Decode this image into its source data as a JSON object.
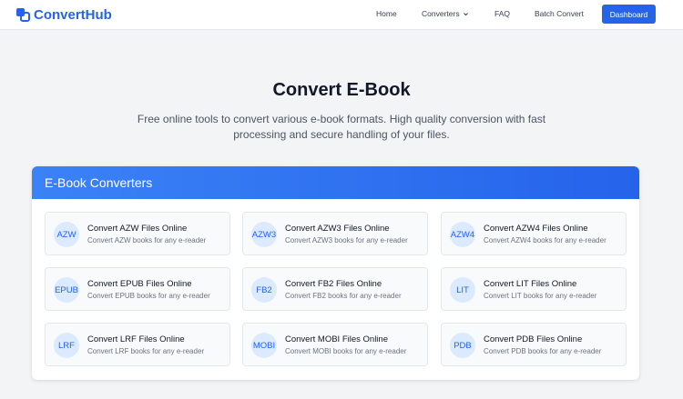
{
  "nav": {
    "brand": "ConvertHub",
    "links": [
      "Home",
      "Converters",
      "FAQ",
      "Batch Convert"
    ],
    "dashboard": "Dashboard"
  },
  "hero": {
    "title": "Convert E-Book",
    "subtitle": "Free online tools to convert various e-book formats. High quality conversion with fast processing and secure handling of your files."
  },
  "section": {
    "title": "E-Book Converters",
    "accent_color": "#2563eb"
  },
  "converters": [
    {
      "code": "AZW",
      "title": "Convert AZW Files Online",
      "desc": "Convert AZW books for any e-reader"
    },
    {
      "code": "AZW3",
      "title": "Convert AZW3 Files Online",
      "desc": "Convert AZW3 books for any e-reader"
    },
    {
      "code": "AZW4",
      "title": "Convert AZW4 Files Online",
      "desc": "Convert AZW4 books for any e-reader"
    },
    {
      "code": "EPUB",
      "title": "Convert EPUB Files Online",
      "desc": "Convert EPUB books for any e-reader"
    },
    {
      "code": "FB2",
      "title": "Convert FB2 Files Online",
      "desc": "Convert FB2 books for any e-reader"
    },
    {
      "code": "LIT",
      "title": "Convert LIT Files Online",
      "desc": "Convert LIT books for any e-reader"
    },
    {
      "code": "LRF",
      "title": "Convert LRF Files Online",
      "desc": "Convert LRF books for any e-reader"
    },
    {
      "code": "MOBI",
      "title": "Convert MOBI Files Online",
      "desc": "Convert MOBI books for any e-reader"
    },
    {
      "code": "PDB",
      "title": "Convert PDB Files Online",
      "desc": "Convert PDB books for any e-reader"
    }
  ]
}
